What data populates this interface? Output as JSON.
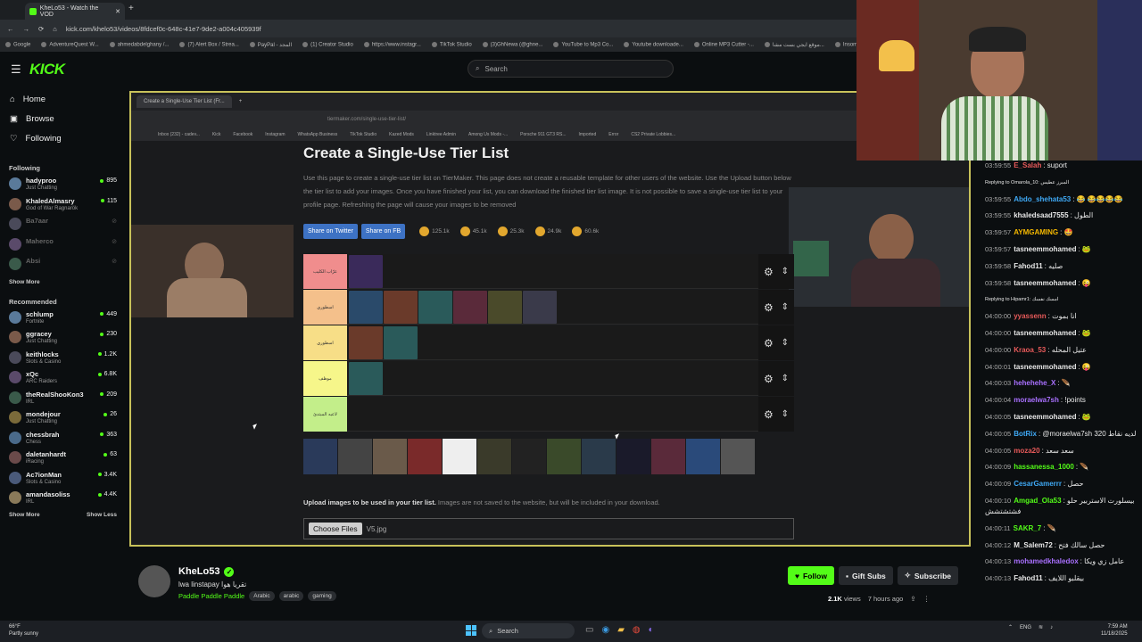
{
  "browser": {
    "tab_title": "KheLo53 - Watch the VOD",
    "url": "kick.com/khelo53/videos/8fdcef0c-648c-41e7-9de2-a004c405939f",
    "bookmarks": [
      "Google",
      "AdventureQuest W...",
      "ahmedabdelghany /...",
      "(7) Alert Box / Strea...",
      "PayPal - المجد",
      "(1) Creator Studio",
      "https://www.instagr...",
      "TikTok Studio",
      "(3)GhNewa (@ghne...",
      "YouTube to Mp3 Co...",
      "Youtube downloade...",
      "Online MP3 Cutter -...",
      "موقع ايجي بست مشا...",
      "Insomniac Events Gl..."
    ]
  },
  "header": {
    "logo": "KICK",
    "search_placeholder": "Search"
  },
  "nav": {
    "home": "Home",
    "browse": "Browse",
    "following": "Following"
  },
  "sidebar": {
    "following_title": "Following",
    "following": [
      {
        "name": "hadyproo",
        "game": "Just Chatting",
        "viewers": "895",
        "live": true
      },
      {
        "name": "KhaledAlmasry",
        "game": "God of War Ragnarök",
        "viewers": "115",
        "live": true
      },
      {
        "name": "Ba7aar",
        "game": "",
        "viewers": "",
        "live": false
      },
      {
        "name": "Maherco",
        "game": "",
        "viewers": "",
        "live": false
      },
      {
        "name": "Absi",
        "game": "",
        "viewers": "",
        "live": false
      }
    ],
    "show_more": "Show More",
    "recommended_title": "Recommended",
    "recommended": [
      {
        "name": "schlump",
        "game": "Fortnite",
        "viewers": "449"
      },
      {
        "name": "ggracey",
        "game": "Just Chatting",
        "viewers": "230"
      },
      {
        "name": "keithlocks",
        "game": "Slots & Casino",
        "viewers": "1.2K"
      },
      {
        "name": "xQc",
        "game": "ARC Raiders",
        "viewers": "6.8K"
      },
      {
        "name": "theRealShooKon3",
        "game": "IRL",
        "viewers": "209"
      },
      {
        "name": "mondejour",
        "game": "Just Chatting",
        "viewers": "26"
      },
      {
        "name": "chessbrah",
        "game": "Chess",
        "viewers": "363"
      },
      {
        "name": "daletanhardt",
        "game": "iRacing",
        "viewers": "63"
      },
      {
        "name": "Ac7ionMan",
        "game": "Slots & Casino",
        "viewers": "3.4K"
      },
      {
        "name": "amandasoliss",
        "game": "IRL",
        "viewers": "4.4K"
      }
    ],
    "show_more2": "Show More",
    "show_less": "Show Less"
  },
  "video": {
    "inner_tab": "Create a Single-Use Tier List (Fr...",
    "inner_url": "tiermaker.com/single-use-tier-list/",
    "inner_bookmarks": [
      "Inbox (232) - cadev...",
      "Kick",
      "Facebook",
      "Instagram",
      "WhatsApp Business",
      "TikTok Studio",
      "Kazed Mods",
      "Linktree Admin",
      "Among Us Mods -...",
      "Porsche 911 GT3 RS...",
      "Imported",
      "Error",
      "CS2 Private Lobbies..."
    ],
    "title": "Create a Single-Use Tier List",
    "description": "Use this page to create a single-use tier list on TierMaker. This page does not create a reusable template for other users of the website. Use the Upload button below the tier list to add your images. Once you have finished your list, you can download the finished tier list image. It is not possible to save a single-use tier list to your profile page. Refreshing the page will cause your images to be removed",
    "share_twitter": "Share on Twitter",
    "share_fb": "Share on FB",
    "reactions": [
      "125.1k",
      "45.1k",
      "25.3k",
      "24.9k",
      "60.6k"
    ],
    "tiers": [
      {
        "label": "عرّاب الكليب",
        "color": "#f08d8d",
        "images": 1
      },
      {
        "label": "اسطوري",
        "color": "#f4c08b",
        "images": 6
      },
      {
        "label": "اسطوري",
        "color": "#f7de87",
        "images": 2
      },
      {
        "label": "موظف",
        "color": "#f6f68a",
        "images": 1
      },
      {
        "label": "لاعبه المبتدئ",
        "color": "#c3ee8a",
        "images": 0
      }
    ],
    "upload_bold": "Upload images to be used in your tier list.",
    "upload_rest": " Images are not saved to the website, but will be included in your download.",
    "choose_files": "Choose Files",
    "file_name": "V5.jpg"
  },
  "stream": {
    "name": "KheLo53",
    "title": "lwa linstapay تقريا هوا",
    "category": "Paddle Paddle Paddle",
    "tags": [
      "Arabic",
      "arabic",
      "gaming"
    ],
    "follow": "Follow",
    "gift_subs": "Gift Subs",
    "subscribe": "Subscribe",
    "views": "2.1K",
    "views_label": "views",
    "ago": "7 hours ago"
  },
  "chat": [
    {
      "t": "03:59:55",
      "u": "E_Salah",
      "c": "#e85a5a",
      "m": ": suport"
    },
    {
      "reply": "Replying to Omarola_10: المبرز عطيس"
    },
    {
      "t": "03:59:55",
      "u": "Abdo_shehata53",
      "c": "#3fa9f5",
      "m": ": 😂 😂😂😂😂"
    },
    {
      "t": "03:59:55",
      "u": "khaledsaad7555",
      "c": "#e8e8e8",
      "m": ": الطول"
    },
    {
      "t": "03:59:57",
      "u": "AYMGAMING",
      "c": "#f5b800",
      "m": ": 🤩"
    },
    {
      "t": "03:59:57",
      "u": "tasneemmohamed",
      "c": "#e8e8e8",
      "m": ": 🐸"
    },
    {
      "t": "03:59:58",
      "u": "Fahod11",
      "c": "#e8e8e8",
      "m": ": صليه"
    },
    {
      "t": "03:59:58",
      "u": "tasneemmohamed",
      "c": "#e8e8e8",
      "m": ": 😜"
    },
    {
      "reply": "Replying to Hipamr1: امسك نفسك"
    },
    {
      "t": "04:00:00",
      "u": "yyassenn",
      "c": "#e85a5a",
      "m": ": انا بموت"
    },
    {
      "t": "04:00:00",
      "u": "tasneemmohamed",
      "c": "#e8e8e8",
      "m": ": 🐸"
    },
    {
      "t": "04:00:00",
      "u": "Kraoa_53",
      "c": "#e85a5a",
      "m": ": عتيل المحله"
    },
    {
      "t": "04:00:01",
      "u": "tasneemmohamed",
      "c": "#e8e8e8",
      "m": ": 😜"
    },
    {
      "t": "04:00:03",
      "u": "hehehehe_X",
      "c": "#a970ff",
      "m": ": 🪶"
    },
    {
      "t": "04:00:04",
      "u": "moraelwa7sh",
      "c": "#a970ff",
      "m": ": !points"
    },
    {
      "t": "04:00:05",
      "u": "tasneemmohamed",
      "c": "#e8e8e8",
      "m": ": 🐸"
    },
    {
      "t": "04:00:05",
      "u": "BotRix",
      "c": "#3fa9f5",
      "m": ": @moraelwa7sh لديه نقاط 320"
    },
    {
      "t": "04:00:05",
      "u": "moza20",
      "c": "#e85a5a",
      "m": ": سعد سعد"
    },
    {
      "t": "04:00:09",
      "u": "hassanessa_1000",
      "c": "#53fc18",
      "m": ": 🪶"
    },
    {
      "t": "04:00:09",
      "u": "CesarGamerrr",
      "c": "#3fa9f5",
      "m": ": حصل"
    },
    {
      "t": "04:00:10",
      "u": "Amgad_Ola53",
      "c": "#53fc18",
      "m": ": بيسلورت الاستربير حلو فشتشتشش"
    },
    {
      "t": "04:00:11",
      "u": "SAKR_7",
      "c": "#53fc18",
      "m": ": 🪶"
    },
    {
      "t": "04:00:12",
      "u": "M_Salem72",
      "c": "#e8e8e8",
      "m": ": حصل سالك فتح"
    },
    {
      "t": "04:00:13",
      "u": "mohamedkhaledox",
      "c": "#a970ff",
      "m": ": عامل زي ويكا"
    },
    {
      "t": "04:00:13",
      "u": "Fahod11",
      "c": "#e8e8e8",
      "m": ": بيقلبو اللايف"
    }
  ],
  "taskbar": {
    "weather_temp": "66°F",
    "weather_desc": "Partly sunny",
    "search": "Search",
    "lang": "ENG",
    "time": "7:59 AM",
    "date": "11/18/2025"
  },
  "colors": {
    "accent": "#53fc18",
    "video_border": "#c8c25a"
  }
}
